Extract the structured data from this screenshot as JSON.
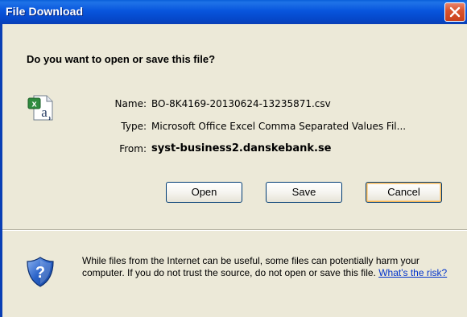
{
  "window": {
    "title": "File Download",
    "close_icon": "close-icon"
  },
  "dialog": {
    "question": "Do you want to open or save this file?",
    "file_icon": "excel-csv-file-icon",
    "fields": {
      "name_label": "Name:",
      "name_value": "BO-8K4169-20130624-13235871.csv",
      "type_label": "Type:",
      "type_value": "Microsoft Office Excel Comma Separated Values Fil...",
      "from_label": "From:",
      "from_value": "syst-business2.danskebank.se"
    },
    "buttons": {
      "open_label": "Open",
      "save_label": "Save",
      "cancel_label": "Cancel"
    },
    "warning": {
      "icon": "security-shield-icon",
      "text": "While files from the Internet can be useful, some files can potentially harm your computer. If you do not trust the source, do not open or save this file.",
      "link_text": "What's the risk?"
    }
  },
  "colors": {
    "titlebar": "#0855dd",
    "dialog_bg": "#ece9d8",
    "close_button": "#d9542f",
    "link": "#0033cc",
    "default_button_highlight": "#f6b85a"
  }
}
